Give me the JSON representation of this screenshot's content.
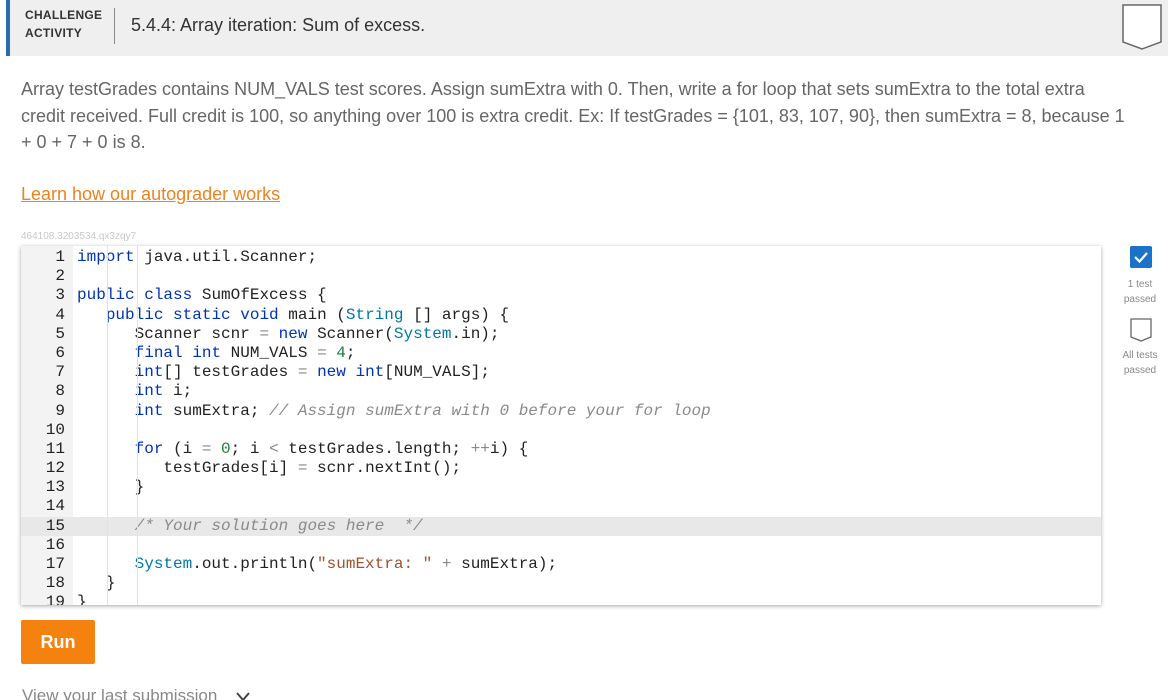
{
  "header": {
    "label_line1": "CHALLENGE",
    "label_line2": "ACTIVITY",
    "title": "5.4.4: Array iteration: Sum of excess."
  },
  "prompt": {
    "text": "Array testGrades contains NUM_VALS test scores. Assign sumExtra with 0. Then, write a for loop that sets sumExtra to the total extra credit received. Full credit is 100, so anything over 100 is extra credit. Ex: If testGrades = {101, 83, 107, 90}, then sumExtra = 8, because 1 + 0 + 7 + 0 is 8.",
    "learn_link": "Learn how our autograder works",
    "activity_id": "464108.3203534.qx3zqy7"
  },
  "editor": {
    "active_line": 15,
    "lines": [
      "import java.util.Scanner;",
      "",
      "public class SumOfExcess {",
      "   public static void main (String [] args) {",
      "      Scanner scnr = new Scanner(System.in);",
      "      final int NUM_VALS = 4;",
      "      int[] testGrades = new int[NUM_VALS];",
      "      int i;",
      "      int sumExtra; // Assign sumExtra with 0 before your for loop",
      "",
      "      for (i = 0; i < testGrades.length; ++i) {",
      "         testGrades[i] = scnr.nextInt();",
      "      }",
      "",
      "      /* Your solution goes here  */",
      "",
      "      System.out.println(\"sumExtra: \" + sumExtra);",
      "   }",
      "}"
    ]
  },
  "tests": {
    "first_label_line1": "1 test",
    "first_label_line2": "passed",
    "second_label_line1": "All tests",
    "second_label_line2": "passed"
  },
  "actions": {
    "run_label": "Run",
    "last_submission_label": "View your last submission"
  },
  "colors": {
    "accent_blue": "#2b6cb0",
    "run_orange": "#f5820f",
    "link_orange": "#f0821e",
    "check_blue": "#1a73c8"
  },
  "icons": {
    "header_badge": "completion-badge-icon",
    "first_test": "checkmark-icon",
    "second_test": "empty-badge-icon",
    "last_submission": "chevron-down-icon"
  }
}
